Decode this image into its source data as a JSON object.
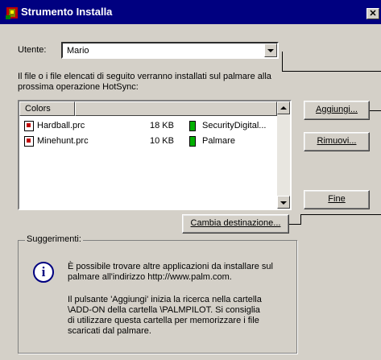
{
  "window": {
    "title": "Strumento Installa",
    "close_glyph": "✕",
    "icon": "palm-install-icon"
  },
  "user": {
    "label": "Utente:",
    "value": "Mario"
  },
  "description": {
    "line1": "Il file o i file elencati di seguito verranno installati sul palmare alla",
    "line2": "prossima operazione HotSync:"
  },
  "file_list": {
    "column_header": "Colors",
    "rows": [
      {
        "name": "Hardball.prc",
        "size": "18 KB",
        "destination": "SecurityDigital..."
      },
      {
        "name": "Minehunt.prc",
        "size": "10 KB",
        "destination": "Palmare"
      }
    ]
  },
  "buttons": {
    "add": "Aggiungi...",
    "remove": "Rimuovi...",
    "done": "Fine",
    "change_destination": "Cambia destinazione..."
  },
  "tips": {
    "title": "Suggerimenti:",
    "para1": [
      "È possibile trovare altre applicazioni da installare sul",
      "palmare all'indirizzo http://www.palm.com."
    ],
    "para2": [
      "Il pulsante 'Aggiungi' inizia la ricerca nella cartella",
      "\\ADD-ON della cartella \\PALMPILOT. Si consiglia",
      "di utilizzare questa cartella per memorizzare i file",
      "scaricati dal palmare."
    ]
  },
  "colors": {
    "titlebar": "#000080",
    "dialog": "#d4d0c8",
    "storage_indicator": "#00b000"
  }
}
